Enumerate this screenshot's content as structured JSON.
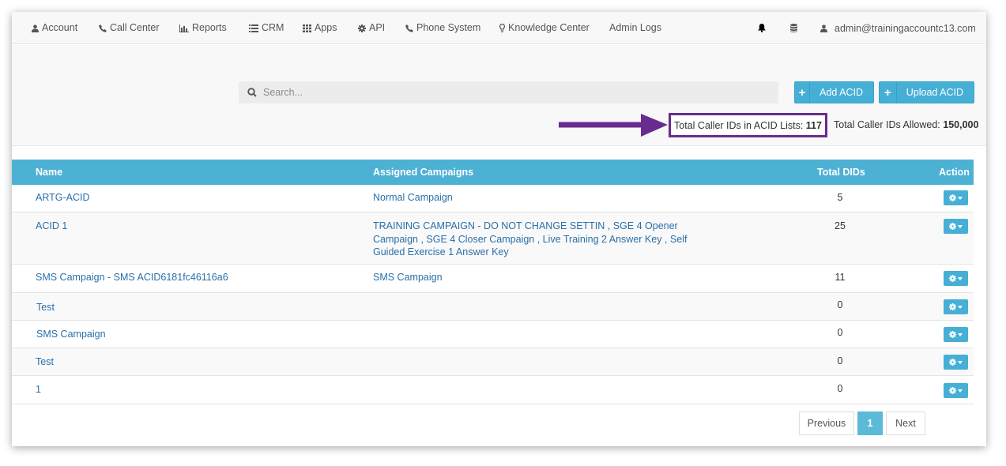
{
  "nav": {
    "items": [
      {
        "label": "Account",
        "icon": "user-icon"
      },
      {
        "label": "Call Center",
        "icon": "phone-icon"
      },
      {
        "label": "Reports",
        "icon": "bar-chart-icon"
      },
      {
        "label": "CRM",
        "icon": "list-icon"
      },
      {
        "label": "Apps",
        "icon": "grid-icon"
      },
      {
        "label": "API",
        "icon": "gear-icon"
      },
      {
        "label": "Phone System",
        "icon": "phone-icon"
      },
      {
        "label": "Knowledge Center",
        "icon": "lightbulb-icon"
      },
      {
        "label": "Admin Logs",
        "icon": ""
      }
    ],
    "user": "admin@trainingaccountc13.com"
  },
  "search": {
    "placeholder": "Search..."
  },
  "buttons": {
    "add": "Add ACID",
    "upload": "Upload ACID"
  },
  "stats": {
    "in_lists_label": "Total Caller IDs in ACID Lists:",
    "in_lists_value": "117",
    "allowed_label": "Total Caller IDs Allowed:",
    "allowed_value": "150,000"
  },
  "table": {
    "headers": {
      "name": "Name",
      "campaigns": "Assigned Campaigns",
      "dids": "Total DIDs",
      "action": "Action"
    },
    "rows": [
      {
        "name": "ARTG-ACID",
        "campaigns": "Normal Campaign",
        "dids": "5"
      },
      {
        "name": "ACID 1",
        "campaigns": "TRAINING CAMPAIGN - DO NOT CHANGE SETTIN , SGE 4 Opener Campaign , SGE 4 Closer Campaign , Live Training 2 Answer Key , Self Guided Exercise 1 Answer Key",
        "dids": "25"
      },
      {
        "name": "SMS Campaign - SMS ACID6181fc46116a6",
        "campaigns": "SMS Campaign",
        "dids": "11"
      },
      {
        "name": "Test",
        "campaigns": "",
        "dids": "0"
      },
      {
        "name": "SMS Campaign",
        "campaigns": "",
        "dids": "0"
      },
      {
        "name": "Test",
        "campaigns": "",
        "dids": "0"
      },
      {
        "name": "1",
        "campaigns": "",
        "dids": "0"
      }
    ]
  },
  "pagination": {
    "previous": "Previous",
    "page": "1",
    "next": "Next"
  }
}
